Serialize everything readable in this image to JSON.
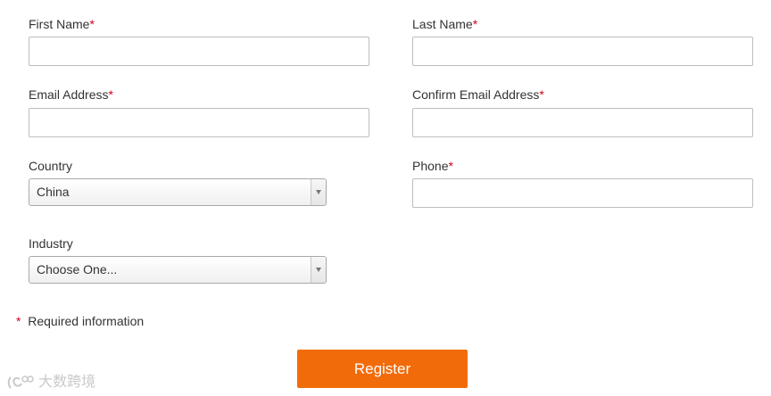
{
  "form": {
    "first_name": {
      "label": "First Name",
      "required_mark": "*",
      "value": ""
    },
    "last_name": {
      "label": "Last Name",
      "required_mark": "*",
      "value": ""
    },
    "email": {
      "label": "Email Address",
      "required_mark": "*",
      "value": ""
    },
    "confirm_email": {
      "label": "Confirm Email Address",
      "required_mark": "*",
      "value": ""
    },
    "country": {
      "label": "Country",
      "selected": "China"
    },
    "phone": {
      "label": "Phone",
      "required_mark": "*",
      "value": ""
    },
    "industry": {
      "label": "Industry",
      "selected": "Choose One..."
    },
    "required_note": {
      "mark": "*",
      "text": "Required information"
    },
    "register_label": "Register"
  },
  "watermark": {
    "text": "大数跨境"
  },
  "colors": {
    "accent": "#f26b0a",
    "required": "#d0021b",
    "text": "#333333",
    "border": "#bdbdbd"
  }
}
